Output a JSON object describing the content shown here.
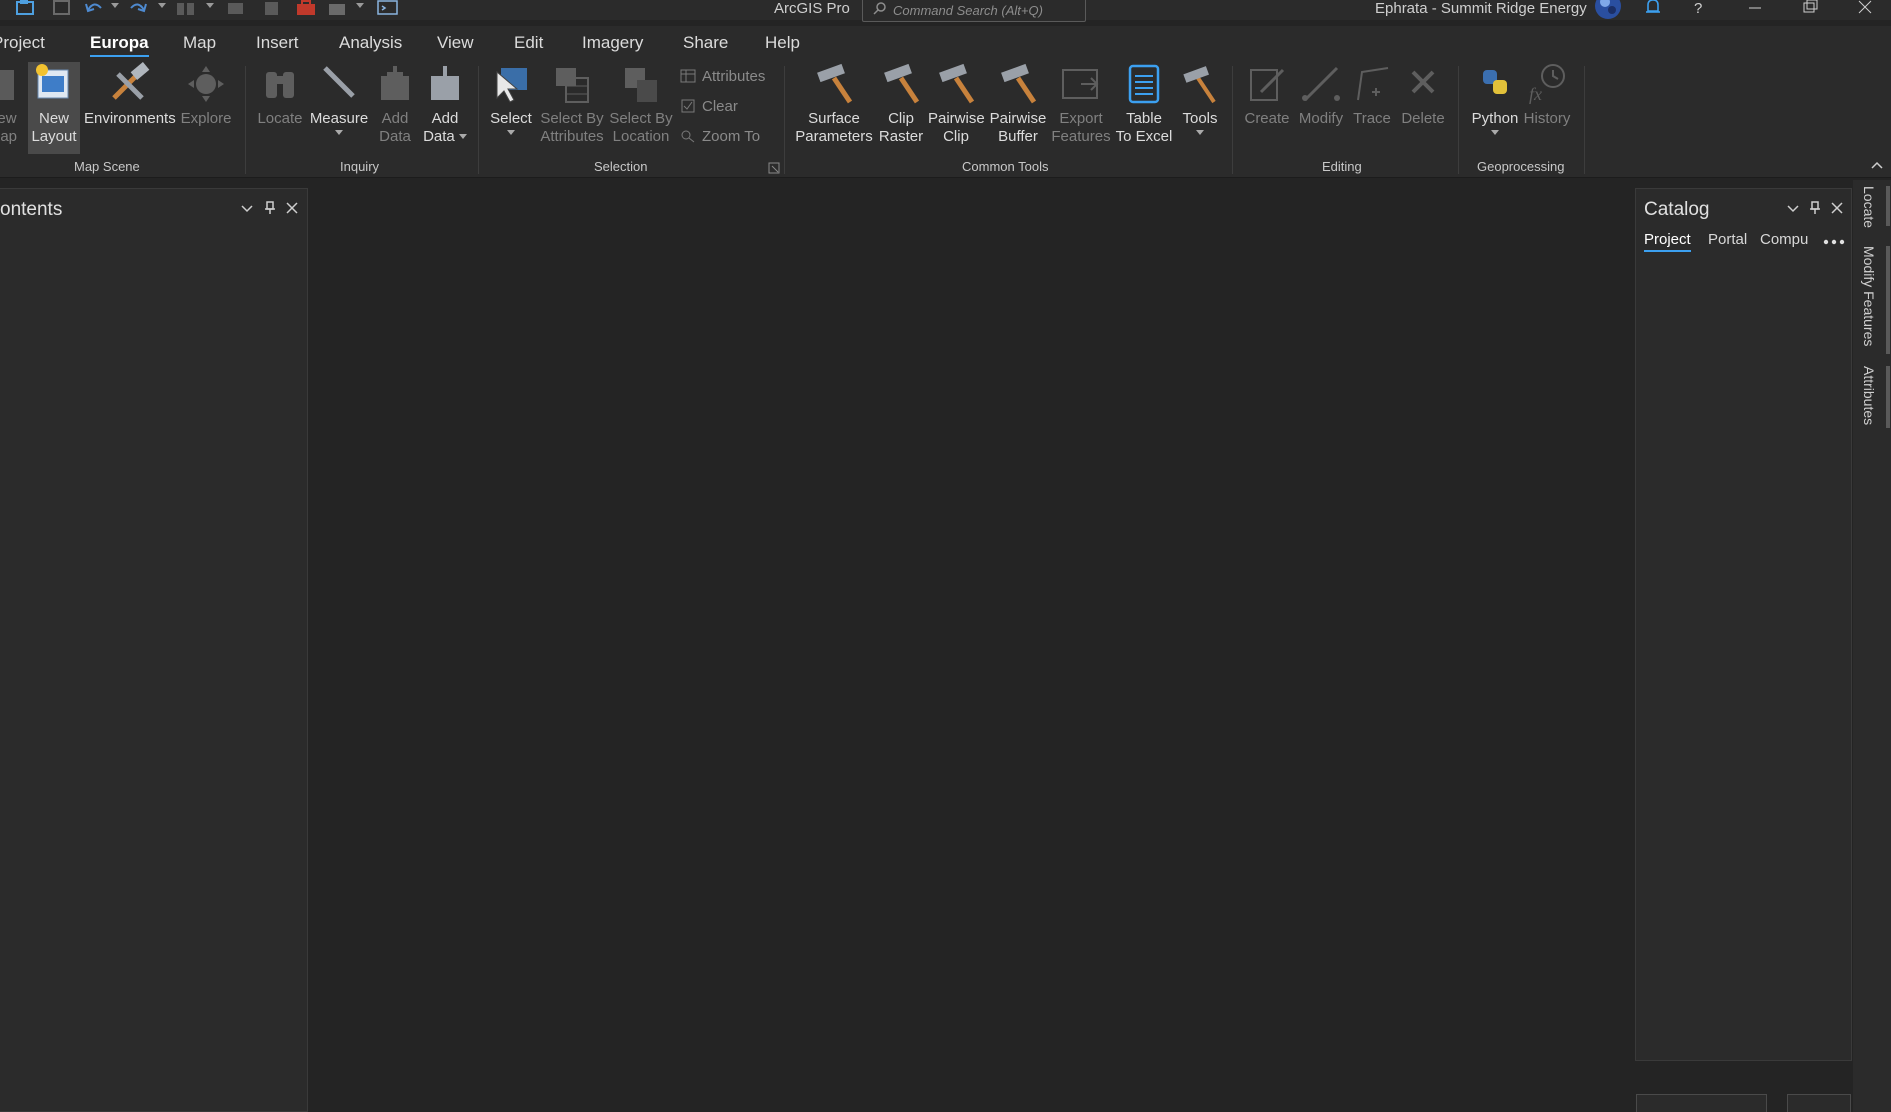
{
  "title_bar": {
    "app_title": "ArcGIS Pro",
    "command_search_placeholder": "Command Search (Alt+Q)",
    "project_name": "Ephrata - Summit Ridge Energy"
  },
  "tabs": [
    {
      "label": "Project"
    },
    {
      "label": "Europa",
      "active": true
    },
    {
      "label": "Map"
    },
    {
      "label": "Insert"
    },
    {
      "label": "Analysis"
    },
    {
      "label": "View"
    },
    {
      "label": "Edit"
    },
    {
      "label": "Imagery"
    },
    {
      "label": "Share"
    },
    {
      "label": "Help"
    }
  ],
  "ribbon": {
    "map_scene": {
      "group_label": "Map Scene",
      "new_map_line1": "ew",
      "new_map_line2": "lap",
      "new_layout_line1": "New",
      "new_layout_line2": "Layout",
      "environments": "Environments",
      "explore": "Explore"
    },
    "inquiry": {
      "group_label": "Inquiry",
      "locate": "Locate",
      "measure": "Measure",
      "add_data1_line1": "Add",
      "add_data1_line2": "Data",
      "add_data2_line1": "Add",
      "add_data2_line2": "Data"
    },
    "selection": {
      "group_label": "Selection",
      "select": "Select",
      "select_by_attributes_line1": "Select By",
      "select_by_attributes_line2": "Attributes",
      "select_by_location_line1": "Select By",
      "select_by_location_line2": "Location",
      "attributes": "Attributes",
      "clear": "Clear",
      "zoom_to": "Zoom To"
    },
    "common_tools": {
      "group_label": "Common Tools",
      "surface_parameters_line1": "Surface",
      "surface_parameters_line2": "Parameters",
      "clip_raster_line1": "Clip",
      "clip_raster_line2": "Raster",
      "pairwise_clip_line1": "Pairwise",
      "pairwise_clip_line2": "Clip",
      "pairwise_buffer_line1": "Pairwise",
      "pairwise_buffer_line2": "Buffer",
      "export_features_line1": "Export",
      "export_features_line2": "Features",
      "table_to_excel_line1": "Table",
      "table_to_excel_line2": "To Excel",
      "tools": "Tools"
    },
    "editing": {
      "group_label": "Editing",
      "create": "Create",
      "modify": "Modify",
      "trace": "Trace",
      "delete": "Delete"
    },
    "geoprocessing": {
      "group_label": "Geoprocessing",
      "python": "Python",
      "history": "History"
    }
  },
  "contents_pane": {
    "title": "ontents"
  },
  "catalog_pane": {
    "title": "Catalog",
    "tabs": [
      {
        "label": "Project",
        "active": true
      },
      {
        "label": "Portal"
      },
      {
        "label": "Compu"
      }
    ]
  },
  "side_dock": {
    "tabs": [
      {
        "label": "Locate"
      },
      {
        "label": "Modify Features"
      },
      {
        "label": "Attributes"
      }
    ]
  },
  "colors": {
    "accent": "#3ca0f0",
    "background": "#242424",
    "panel": "#2b2b2b",
    "hammer_handle": "#c8823c"
  },
  "icons": [
    "new-map-icon",
    "new-layout-icon",
    "environments-icon",
    "explore-icon",
    "locate-icon",
    "measure-icon",
    "add-data-icon",
    "select-icon",
    "select-by-attributes-icon",
    "select-by-location-icon",
    "attributes-icon",
    "clear-icon",
    "zoom-to-icon",
    "hammer-icon",
    "export-features-icon",
    "table-to-excel-icon",
    "create-icon",
    "modify-icon",
    "trace-icon",
    "delete-icon",
    "history-icon",
    "bell-icon",
    "help-icon",
    "search-icon"
  ]
}
